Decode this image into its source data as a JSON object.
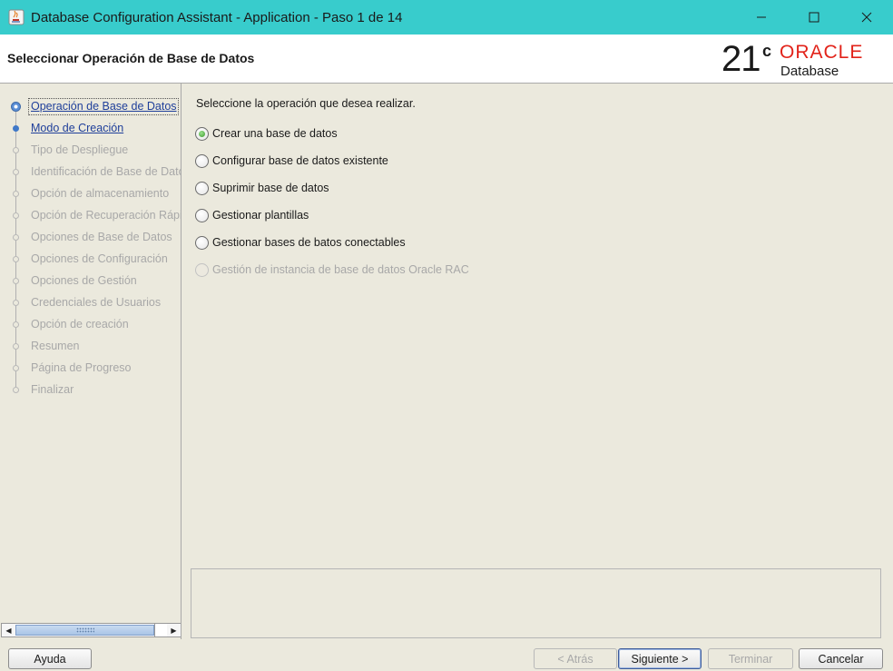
{
  "window": {
    "title": "Database Configuration Assistant - Application - Paso 1 de 14",
    "controls": [
      "minimize",
      "maximize",
      "close"
    ]
  },
  "header": {
    "page_title": "Seleccionar Operación de Base de Datos",
    "logo": {
      "version": "21",
      "version_sup": "c",
      "brand": "ORACLE",
      "product": "Database"
    }
  },
  "sidebar": {
    "steps": [
      {
        "label": "Operación de Base de Datos",
        "state": "current"
      },
      {
        "label": "Modo de Creación",
        "state": "done"
      },
      {
        "label": "Tipo de Despliegue",
        "state": "pending"
      },
      {
        "label": "Identificación de Base de Datos",
        "state": "pending"
      },
      {
        "label": "Opción de almacenamiento",
        "state": "pending"
      },
      {
        "label": "Opción de Recuperación Rápida",
        "state": "pending"
      },
      {
        "label": "Opciones de Base de Datos",
        "state": "pending"
      },
      {
        "label": "Opciones de Configuración",
        "state": "pending"
      },
      {
        "label": "Opciones de Gestión",
        "state": "pending"
      },
      {
        "label": "Credenciales de Usuarios",
        "state": "pending"
      },
      {
        "label": "Opción de creación",
        "state": "pending"
      },
      {
        "label": "Resumen",
        "state": "pending"
      },
      {
        "label": "Página de Progreso",
        "state": "pending"
      },
      {
        "label": "Finalizar",
        "state": "pending"
      }
    ]
  },
  "main": {
    "prompt": "Seleccione la operación que desea realizar.",
    "options": [
      {
        "label": "Crear una base de datos",
        "checked": true,
        "enabled": true
      },
      {
        "label": "Configurar base de datos existente",
        "checked": false,
        "enabled": true
      },
      {
        "label": "Suprimir base de datos",
        "checked": false,
        "enabled": true
      },
      {
        "label": "Gestionar plantillas",
        "checked": false,
        "enabled": true
      },
      {
        "label": "Gestionar bases de batos conectables",
        "checked": false,
        "enabled": true
      },
      {
        "label": "Gestión de instancia de base de datos Oracle RAC",
        "checked": false,
        "enabled": false
      }
    ],
    "description": ""
  },
  "buttons": {
    "help": "Ayuda",
    "back": "< Atrás",
    "next": "Siguiente >",
    "finish": "Terminar",
    "cancel": "Cancelar"
  },
  "colors": {
    "titlebar": "#38cccc",
    "oracle_red": "#e2231a",
    "link_blue": "#1f3f9a",
    "panel_bg": "#ebe9dd"
  }
}
